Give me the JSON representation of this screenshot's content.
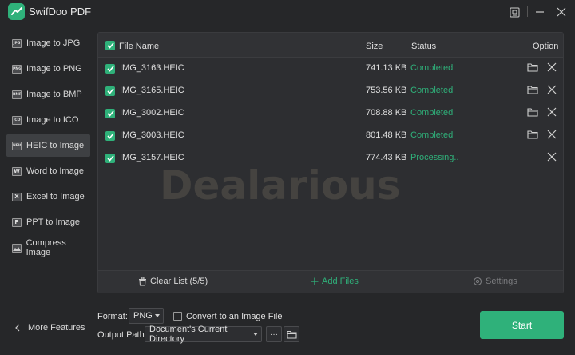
{
  "app": {
    "title": "SwifDoo PDF"
  },
  "sidebar": {
    "items": [
      {
        "label": "Image to JPG",
        "icon": "jpg-file-icon",
        "glyph": "JPG"
      },
      {
        "label": "Image to PNG",
        "icon": "png-file-icon",
        "glyph": "PNG"
      },
      {
        "label": "Image to BMP",
        "icon": "bmp-file-icon",
        "glyph": "BMP"
      },
      {
        "label": "Image to ICO",
        "icon": "ico-file-icon",
        "glyph": "ICO"
      },
      {
        "label": "HEIC to Image",
        "icon": "heic-file-icon",
        "glyph": "HEIC",
        "active": true
      },
      {
        "label": "Word to Image",
        "icon": "word-file-icon",
        "glyph": "W"
      },
      {
        "label": "Excel to Image",
        "icon": "excel-file-icon",
        "glyph": "X"
      },
      {
        "label": "PPT to Image",
        "icon": "ppt-file-icon",
        "glyph": "P"
      },
      {
        "label": "Compress Image",
        "icon": "compress-image-icon",
        "glyph": ""
      }
    ],
    "more_features": "More Features"
  },
  "table": {
    "headers": {
      "file_name": "File Name",
      "size": "Size",
      "status": "Status",
      "option": "Option"
    },
    "rows": [
      {
        "name": "IMG_3163.HEIC",
        "size": "741.13 KB",
        "status": "Completed",
        "done": true
      },
      {
        "name": "IMG_3165.HEIC",
        "size": "753.56 KB",
        "status": "Completed",
        "done": true
      },
      {
        "name": "IMG_3002.HEIC",
        "size": "708.88 KB",
        "status": "Completed",
        "done": true
      },
      {
        "name": "IMG_3003.HEIC",
        "size": "801.48 KB",
        "status": "Completed",
        "done": true
      },
      {
        "name": "IMG_3157.HEIC",
        "size": "774.43 KB",
        "status": "Processing..",
        "done": false
      }
    ]
  },
  "watermark": "Dealarious",
  "footer": {
    "clear_list": "Clear List (5/5)",
    "add_files": "Add Files",
    "settings": "Settings"
  },
  "options": {
    "format_label": "Format:",
    "format_value": "PNG",
    "convert_label": "Convert to an Image File",
    "output_label": "Output Path:",
    "output_value": "Document's Current Directory",
    "more_label": "···"
  },
  "start_label": "Start",
  "colors": {
    "accent": "#2fb17a",
    "background": "#262729",
    "panel": "#2d2e31"
  }
}
